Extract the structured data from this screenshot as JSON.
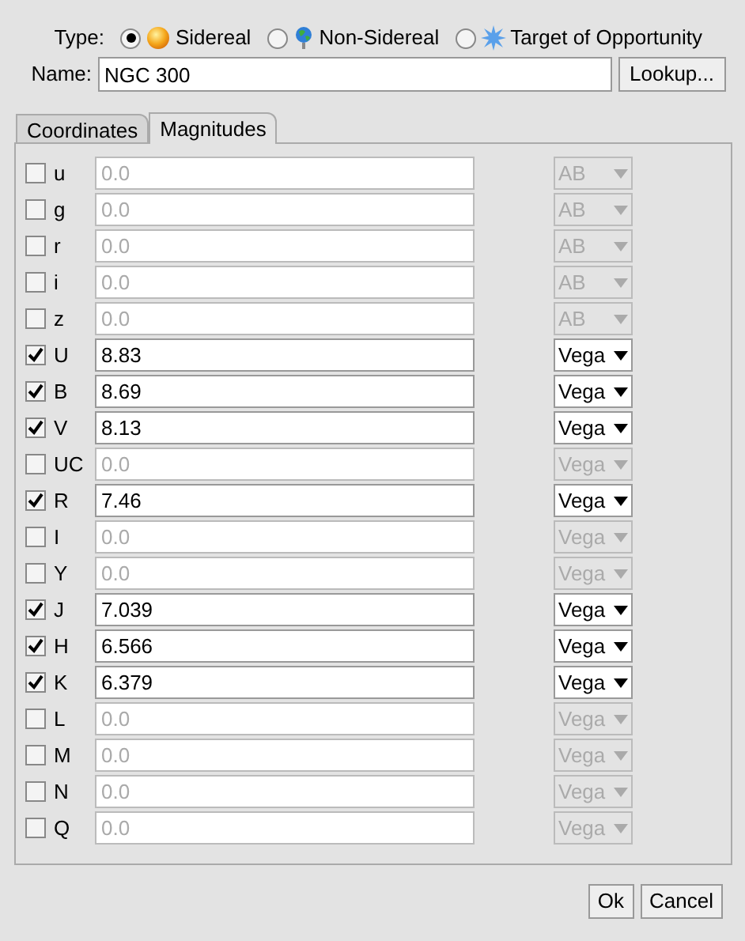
{
  "type": {
    "label": "Type:",
    "options": [
      {
        "label": "Sidereal",
        "kind": "sun",
        "selected": true
      },
      {
        "label": "Non-Sidereal",
        "kind": "globe",
        "selected": false
      },
      {
        "label": "Target of Opportunity",
        "kind": "star",
        "selected": false
      }
    ]
  },
  "name": {
    "label": "Name:",
    "value": "NGC 300",
    "button": "Lookup..."
  },
  "tabs": [
    {
      "label": "Coordinates",
      "selected": false
    },
    {
      "label": "Magnitudes",
      "selected": true
    }
  ],
  "magnitudes": [
    {
      "band": "u",
      "checked": false,
      "value": "0.0",
      "system": "AB"
    },
    {
      "band": "g",
      "checked": false,
      "value": "0.0",
      "system": "AB"
    },
    {
      "band": "r",
      "checked": false,
      "value": "0.0",
      "system": "AB"
    },
    {
      "band": "i",
      "checked": false,
      "value": "0.0",
      "system": "AB"
    },
    {
      "band": "z",
      "checked": false,
      "value": "0.0",
      "system": "AB"
    },
    {
      "band": "U",
      "checked": true,
      "value": "8.83",
      "system": "Vega"
    },
    {
      "band": "B",
      "checked": true,
      "value": "8.69",
      "system": "Vega"
    },
    {
      "band": "V",
      "checked": true,
      "value": "8.13",
      "system": "Vega"
    },
    {
      "band": "UC",
      "checked": false,
      "value": "0.0",
      "system": "Vega"
    },
    {
      "band": "R",
      "checked": true,
      "value": "7.46",
      "system": "Vega"
    },
    {
      "band": "I",
      "checked": false,
      "value": "0.0",
      "system": "Vega"
    },
    {
      "band": "Y",
      "checked": false,
      "value": "0.0",
      "system": "Vega"
    },
    {
      "band": "J",
      "checked": true,
      "value": "7.039",
      "system": "Vega"
    },
    {
      "band": "H",
      "checked": true,
      "value": "6.566",
      "system": "Vega"
    },
    {
      "band": "K",
      "checked": true,
      "value": "6.379",
      "system": "Vega"
    },
    {
      "band": "L",
      "checked": false,
      "value": "0.0",
      "system": "Vega"
    },
    {
      "band": "M",
      "checked": false,
      "value": "0.0",
      "system": "Vega"
    },
    {
      "band": "N",
      "checked": false,
      "value": "0.0",
      "system": "Vega"
    },
    {
      "band": "Q",
      "checked": false,
      "value": "0.0",
      "system": "Vega"
    }
  ],
  "buttons": [
    "Ok",
    "Cancel"
  ]
}
